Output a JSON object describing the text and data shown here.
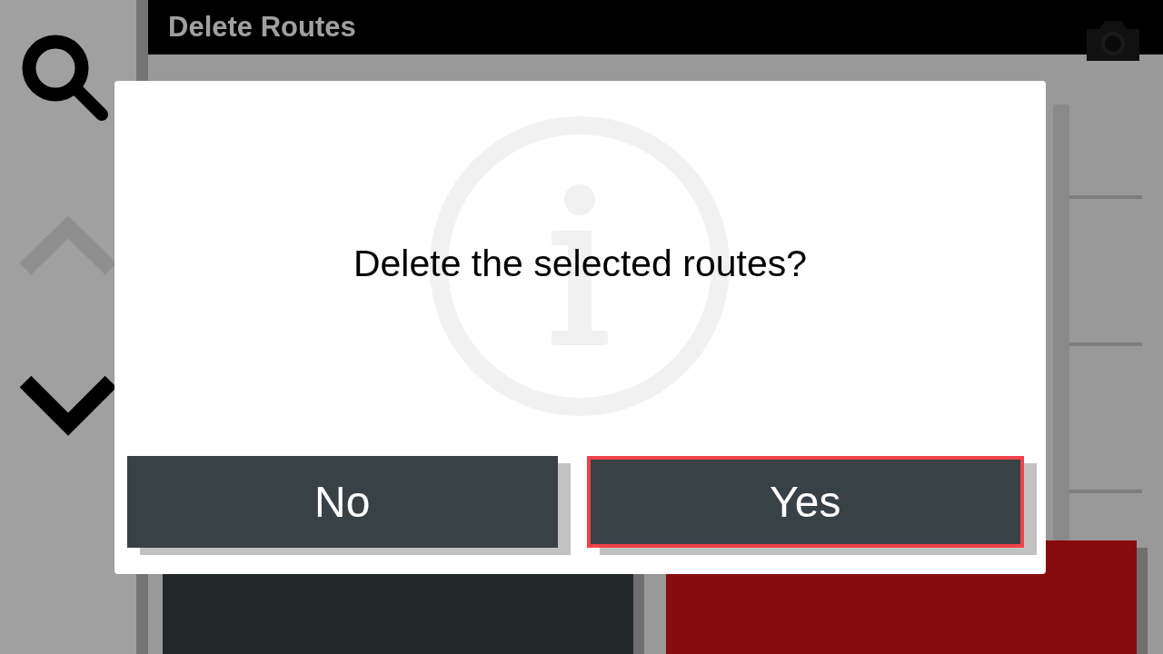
{
  "sidebar": {
    "buttons": [
      {
        "kind": "search",
        "disabled": false
      },
      {
        "kind": "up",
        "disabled": true
      },
      {
        "kind": "down",
        "disabled": false
      }
    ]
  },
  "header": {
    "title": "Delete Routes"
  },
  "background_buttons": [
    {
      "kind": "neutral"
    },
    {
      "kind": "danger"
    }
  ],
  "dialog": {
    "message": "Delete the selected routes?",
    "buttons": [
      {
        "label": "No",
        "selected": false
      },
      {
        "label": "Yes",
        "selected": true
      }
    ]
  }
}
